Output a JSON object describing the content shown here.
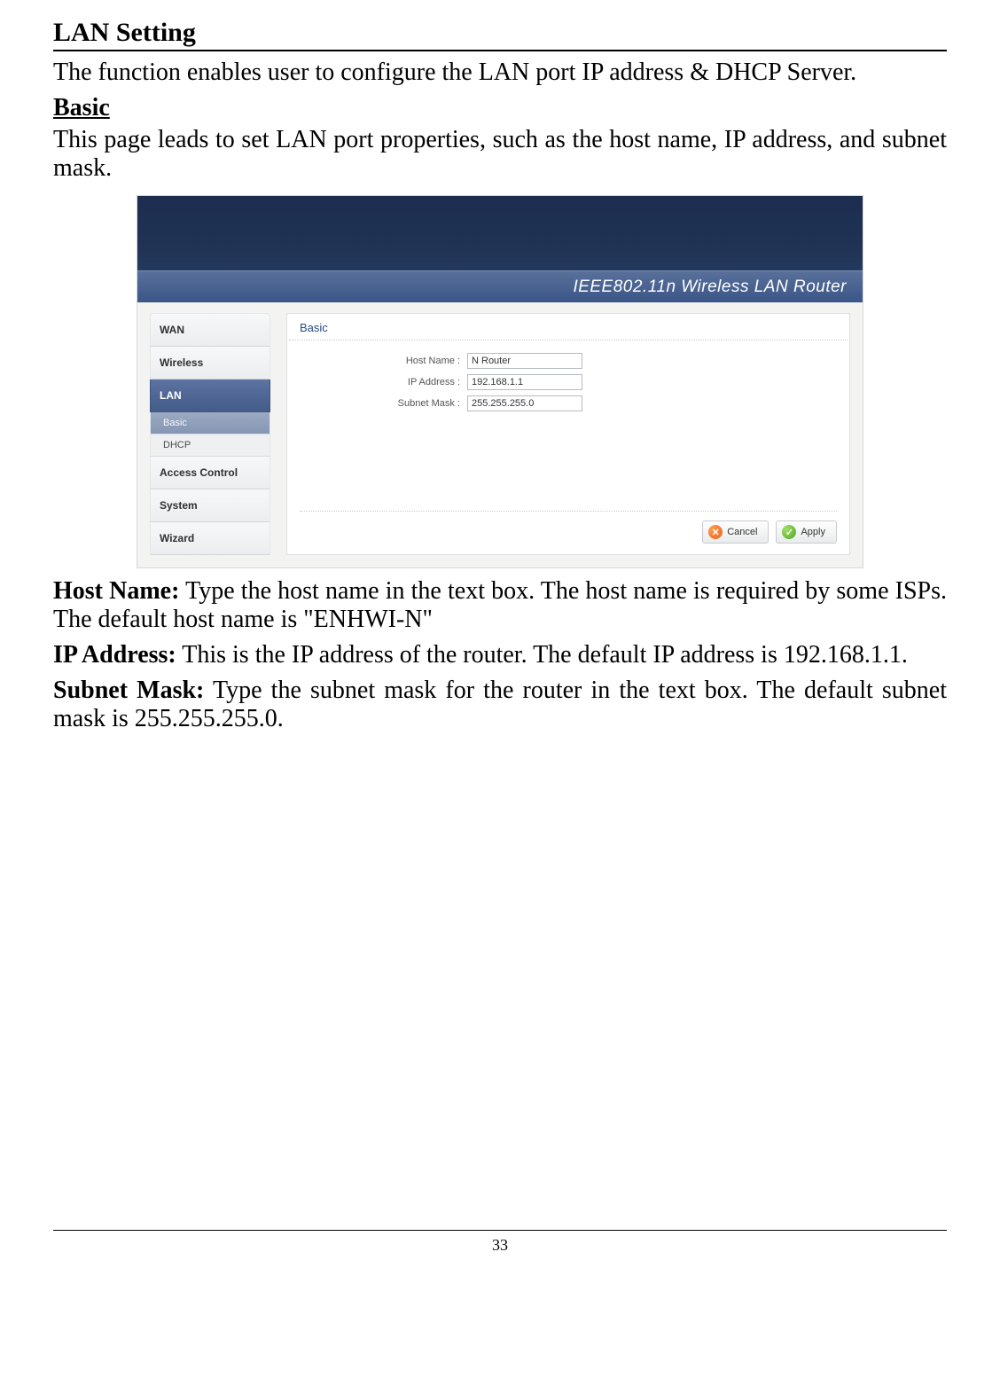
{
  "doc": {
    "title": "LAN Setting",
    "intro": "The function enables user to configure the LAN port IP address & DHCP Server.",
    "section_label": "Basic",
    "section_desc": "This page leads to set LAN port properties, such as the host name, IP address, and subnet mask.",
    "host_name_label": "Host Name:",
    "host_name_text": " Type the host name in the text box. The host name is required by some ISPs. The default host name is \"ENHWI-N\"",
    "ip_label": "IP Address:",
    "ip_text": " This is the IP address of the router. The default IP address is 192.168.1.1.",
    "subnet_label": "Subnet Mask:",
    "subnet_text": " Type the subnet mask for the router in the text box. The default subnet mask is 255.255.255.0.",
    "page_number": "33"
  },
  "router": {
    "header_title": "IEEE802.11n  Wireless LAN Router",
    "nav": {
      "wan": "WAN",
      "wireless": "Wireless",
      "lan": "LAN",
      "basic": "Basic",
      "dhcp": "DHCP",
      "access_control": "Access Control",
      "system": "System",
      "wizard": "Wizard"
    },
    "panel": {
      "title": "Basic",
      "host_name_label": "Host Name :",
      "host_name_value": "N Router",
      "ip_label": "IP Address :",
      "ip_value": "192.168.1.1",
      "subnet_label": "Subnet Mask :",
      "subnet_value": "255.255.255.0",
      "cancel": "Cancel",
      "apply": "Apply"
    }
  }
}
